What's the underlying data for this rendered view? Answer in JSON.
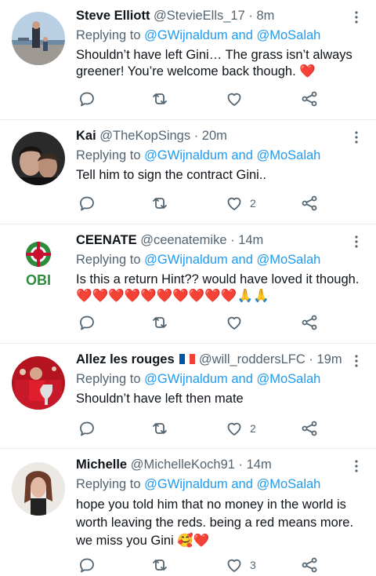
{
  "replying_label": "Replying to",
  "tweets": [
    {
      "name": "Steve Elliott",
      "handle": "@StevieElls_17",
      "time": "· 8m",
      "mentions": [
        "@GWijnaldum",
        "@MoSalah"
      ],
      "mention_joiner": "and",
      "text": "Shouldn’t have left Gini… The grass isn’t always greener! You’re welcome back though. ❤️",
      "replies": "",
      "retweets": "",
      "likes": ""
    },
    {
      "name": "Kai",
      "handle": "@TheKopSings",
      "time": "· 20m",
      "mentions": [
        "@GWijnaldum",
        "@MoSalah"
      ],
      "mention_joiner": "and",
      "text": "Tell him to sign the contract Gini..",
      "replies": "",
      "retweets": "",
      "likes": "2"
    },
    {
      "name": "CEENATE",
      "handle": "@ceenatemike",
      "time": "· 14m",
      "avatar_text": "OBI",
      "mentions": [
        "@GWijnaldum",
        "@MoSalah"
      ],
      "mention_joiner": "and",
      "text": "Is this a return Hint?? would have loved it though. ❤️❤️❤️❤️❤️❤️❤️❤️❤️❤️🙏🙏",
      "replies": "",
      "retweets": "",
      "likes": ""
    },
    {
      "name": "Allez les rouges",
      "handle": "@will_roddersLFC",
      "time": "· 19m",
      "mentions": [
        "@GWijnaldum",
        "@MoSalah"
      ],
      "mention_joiner": "and",
      "text": "Shouldn’t have left then mate",
      "replies": "",
      "retweets": "",
      "likes": "2"
    },
    {
      "name": "Michelle",
      "handle": "@MichelleKoch91",
      "time": "· 14m",
      "mentions": [
        "@GWijnaldum",
        "@MoSalah"
      ],
      "mention_joiner": "and",
      "text": "hope you told him that no money in the world is worth leaving the reds. being a red means more. we miss you Gini 🥰❤️",
      "replies": "",
      "retweets": "",
      "likes": "3"
    }
  ],
  "colors": {
    "text": "#0f1419",
    "muted": "#536471",
    "link": "#1d9bf0",
    "divider": "#e6ecf0",
    "heart": "#e0245e"
  }
}
